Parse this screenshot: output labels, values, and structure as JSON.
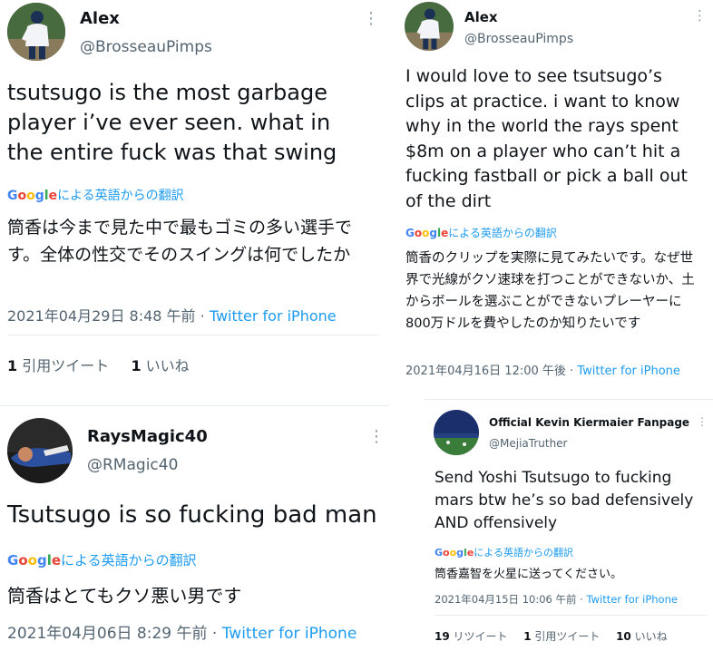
{
  "translate": {
    "google": [
      "G",
      "o",
      "o",
      "g",
      "l",
      "e"
    ],
    "google_colors": [
      "#4285F4",
      "#EA4335",
      "#FBBC05",
      "#4285F4",
      "#34A853",
      "#EA4335"
    ],
    "label": "による英語からの翻訳"
  },
  "tweets": [
    {
      "name": "Alex",
      "handle": "@BrosseauPimps",
      "text": "tsutsugo is the most garbage player i’ve ever seen. what in the entire fuck was that swing",
      "translation": "筒香は今まで見た中で最もゴミの多い選手です。全体の性交でそのスイングは何でしたか",
      "date": "2021年04月29日 8:48 午前",
      "sep": " · ",
      "source": "Twitter for iPhone",
      "stats": [
        {
          "count": "1",
          "label": "引用ツイート"
        },
        {
          "count": "1",
          "label": "いいね"
        }
      ]
    },
    {
      "name": "Alex",
      "handle": "@BrosseauPimps",
      "text": "I would love to see tsutsugo’s clips at practice. i want to know why in the world the rays spent $8m on a player who can’t hit a fucking fastball or pick a ball out of the dirt",
      "translation": "筒香のクリップを実際に見てみたいです。なぜ世界で光線がクソ速球を打つことができないか、土からボールを選ぶことができないプレーヤーに800万ドルを費やしたのか知りたいです",
      "date": "2021年04月16日 12:00 午後",
      "sep": " · ",
      "source": "Twitter for iPhone"
    },
    {
      "name": "RaysMagic40",
      "handle": "@RMagic40",
      "text": "Tsutsugo is so fucking bad man",
      "translation": "筒香はとてもクソ悪い男です",
      "date": "2021年04月06日 8:29 午前",
      "sep": " · ",
      "source": "Twitter for iPhone"
    },
    {
      "name": "Official Kevin Kiermaier Fanpage",
      "handle": "@MejiaTruther",
      "text": "Send Yoshi Tsutsugo to fucking mars btw he’s so bad defensively AND offensively",
      "translation": "筒香嘉智を火星に送ってください。",
      "date": "2021年04月15日 10:06 午前",
      "sep": " · ",
      "source": "Twitter for iPhone",
      "stats": [
        {
          "count": "19",
          "label": "リツイート"
        },
        {
          "count": "1",
          "label": "引用ツイート"
        },
        {
          "count": "10",
          "label": "いいね"
        }
      ]
    }
  ],
  "more_glyph": "⋮"
}
